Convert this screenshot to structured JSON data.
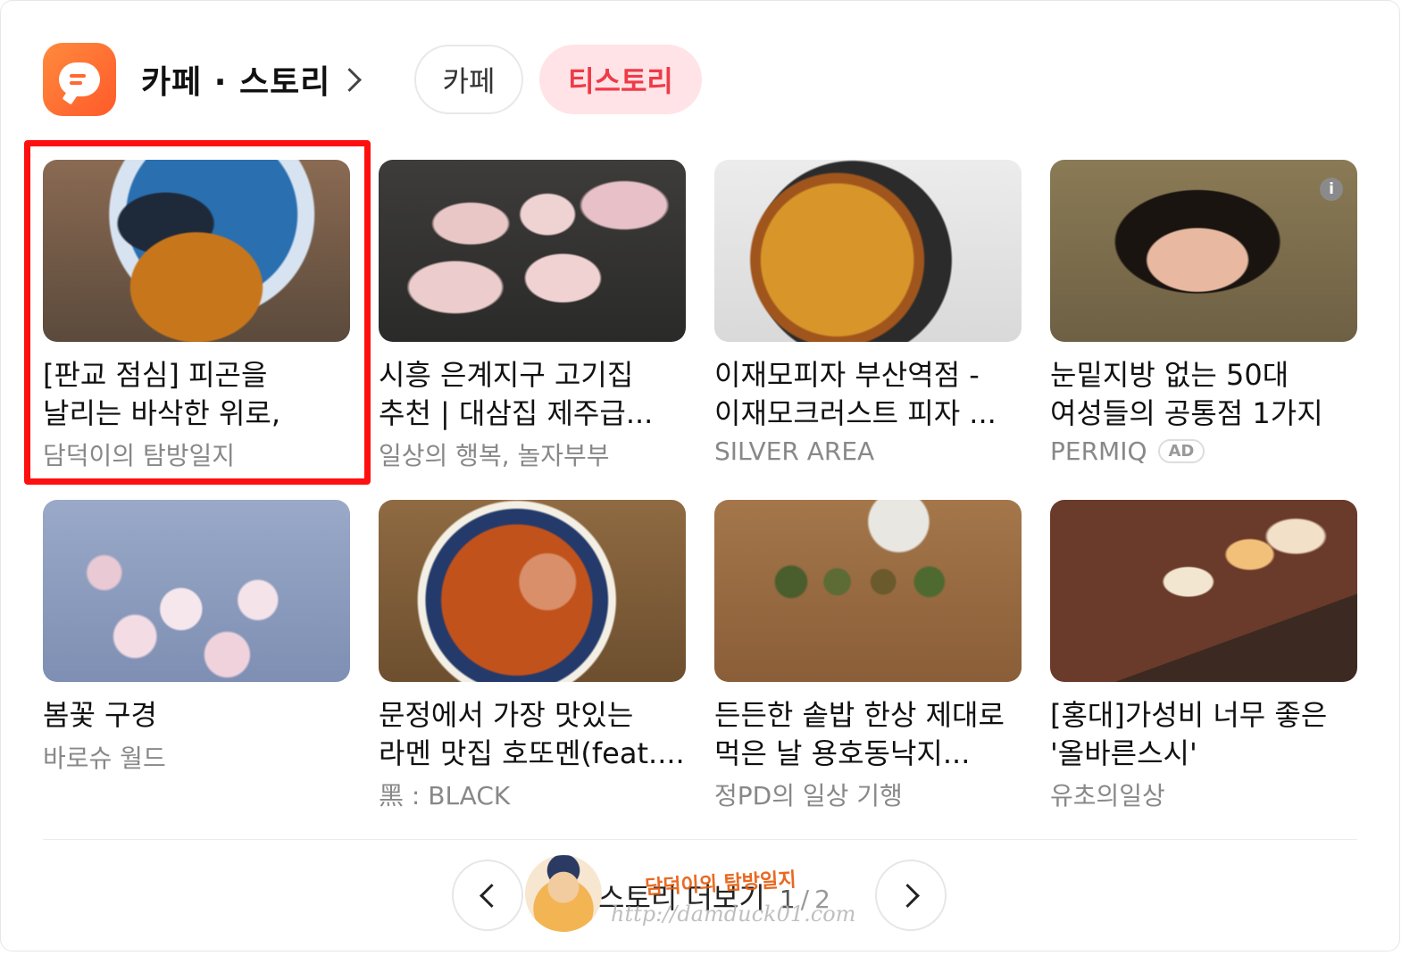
{
  "header": {
    "title": "카페 · 스토리",
    "tabs": [
      {
        "label": "카페",
        "active": false
      },
      {
        "label": "티스토리",
        "active": true
      }
    ]
  },
  "cards": [
    {
      "title": "[판교 점심] 피곤을 날리는 바삭한 위로, 고쿠...",
      "source": "담덕이의 탐방일지",
      "ad": "",
      "image": "tempura-bowl"
    },
    {
      "title": "시흥 은계지구 고기집 추천 | 대삼집 제주급...",
      "source": "일상의 행복, 놀자부부",
      "ad": "",
      "image": "pork-belly-grill"
    },
    {
      "title": "이재모피자 부산역점 - 이재모크러스트 피자 ...",
      "source": "SILVER AREA",
      "ad": "",
      "image": "pizza"
    },
    {
      "title": "눈밑지방 없는 50대 여성들의 공통점 1가지",
      "source": "PERMIQ",
      "ad": "AD",
      "image": "woman-portrait"
    },
    {
      "title": "봄꽃 구경",
      "source": "바로슈 월드",
      "ad": "",
      "image": "cherry-blossom"
    },
    {
      "title": "문정에서 가장 맛있는 라멘 맛집 호또멘(feat....",
      "source": "黑 : BLACK",
      "ad": "",
      "image": "ramen"
    },
    {
      "title": "든든한 솥밥 한상 제대로 먹은 날 용호동낙지...",
      "source": "정PD의 일상 기행",
      "ad": "",
      "image": "korean-table"
    },
    {
      "title": "[홍대]가성비 너무 좋은 '올바른스시'",
      "source": "유초의일상",
      "ad": "",
      "image": "sushi"
    }
  ],
  "pager": {
    "more_label": "스토리 더보기",
    "current": "1",
    "separator": "/",
    "total": "2"
  },
  "watermark": {
    "name": "담덕이의 탐방일지",
    "url": "http://damduck01.com"
  },
  "colors": {
    "brand_orange": "#ff6a30",
    "active_tab_bg": "#ffe3e6",
    "active_tab_text": "#ef3a48",
    "highlight_red": "#ff1010"
  },
  "icons": {
    "logo": "chat-bubble-icon",
    "info": "info-icon",
    "prev": "chevron-left-icon",
    "next": "chevron-right-icon"
  }
}
